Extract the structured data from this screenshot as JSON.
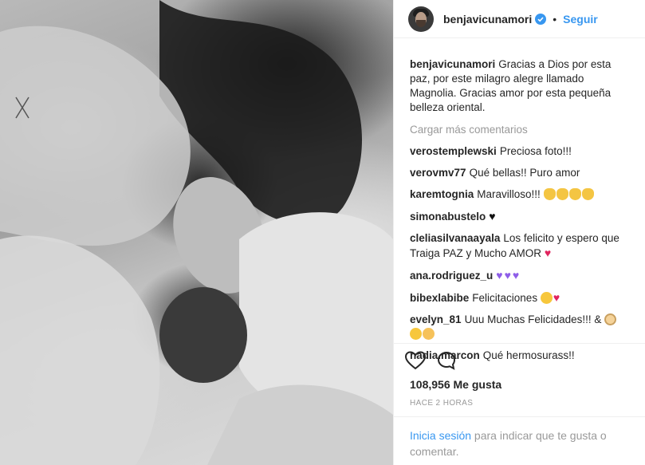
{
  "post": {
    "username": "benjavicunamori",
    "follow_label": "Seguir",
    "separator": "•",
    "caption": "Gracias a Dios por esta paz, por este milagro alegre llamado Magnolia. Gracias amor por esta pequeña belleza oriental.",
    "load_more": "Cargar más comentarios",
    "likes": "108,956 Me gusta",
    "time": "HACE 2 HORAS",
    "login_link": "Inicia sesión",
    "login_text": " para indicar que te gusta o comentar."
  },
  "comments": [
    {
      "user": "verostemplewski",
      "text": "Preciosa foto!!!"
    },
    {
      "user": "verovmv77",
      "text": "Qué bellas!! Puro amor"
    },
    {
      "user": "karemtognia",
      "text": "Maravilloso!!!"
    },
    {
      "user": "simonabustelo",
      "text": ""
    },
    {
      "user": "cleliasilvanaayala",
      "text": "Los felicito y espero que Traiga PAZ y Mucho AMOR"
    },
    {
      "user": "ana.rodriguez_u",
      "text": ""
    },
    {
      "user": "bibexlabibe",
      "text": "Felicitaciones"
    },
    {
      "user": "evelyn_81",
      "text": "Uuu Muchas Felicidades!!! &"
    },
    {
      "user": "nadia.marcon",
      "text": "Qué hermosurass!!"
    }
  ],
  "icons": {
    "verified": "verified-badge-icon",
    "like": "heart-outline-icon",
    "comment": "comment-bubble-icon"
  },
  "colors": {
    "link_blue": "#3897f0",
    "muted": "#999999",
    "text": "#262626"
  }
}
